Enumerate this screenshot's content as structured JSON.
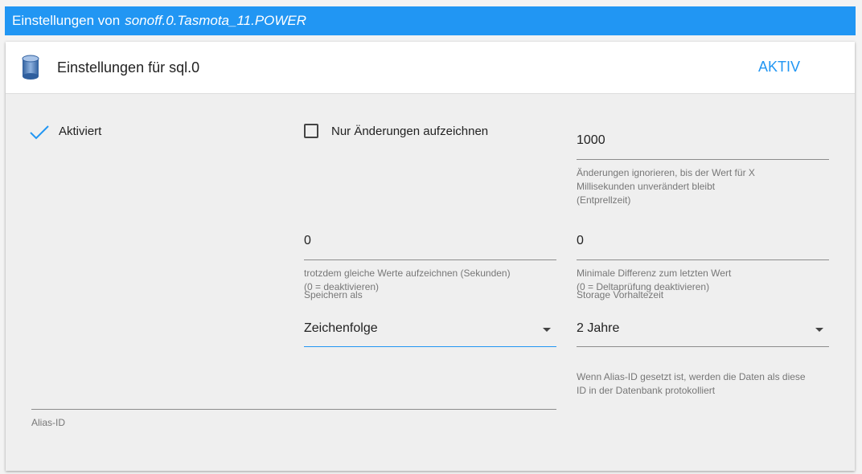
{
  "dialog": {
    "title_prefix": "Einstellungen von",
    "object_id": "sonoff.0.Tasmota_11.POWER"
  },
  "panel": {
    "title": "Einstellungen für sql.0",
    "status": "AKTIV",
    "icon": "database-icon"
  },
  "settings": {
    "enabled": {
      "label": "Aktiviert",
      "checked": true
    },
    "changes_only": {
      "label": "Nur Änderungen aufzeichnen",
      "checked": false
    },
    "debounce": {
      "value": "1000",
      "helper": [
        "Änderungen ignorieren, bis der Wert für X",
        "Millisekunden unverändert bleibt",
        "(Entprellzeit)"
      ]
    },
    "same_values": {
      "value": "0",
      "helper": [
        "trotzdem gleiche Werte aufzeichnen (Sekunden)",
        "(0 = deaktivieren)"
      ]
    },
    "min_diff": {
      "value": "0",
      "helper": [
        "Minimale Differenz zum letzten Wert",
        "(0 = Deltaprüfung deaktivieren)"
      ]
    },
    "store_as": {
      "label": "Speichern als",
      "value": "Zeichenfolge"
    },
    "retention": {
      "label": "Storage Vorhaltezeit",
      "value": "2 Jahre"
    },
    "alias": {
      "label": "Alias-ID",
      "value": "",
      "helper": [
        "Wenn Alias-ID gesetzt ist, werden die Daten als diese",
        "ID in der Datenbank protokolliert"
      ]
    }
  },
  "colors": {
    "accent": "#2196f3",
    "header_bar": "#2196f3"
  }
}
